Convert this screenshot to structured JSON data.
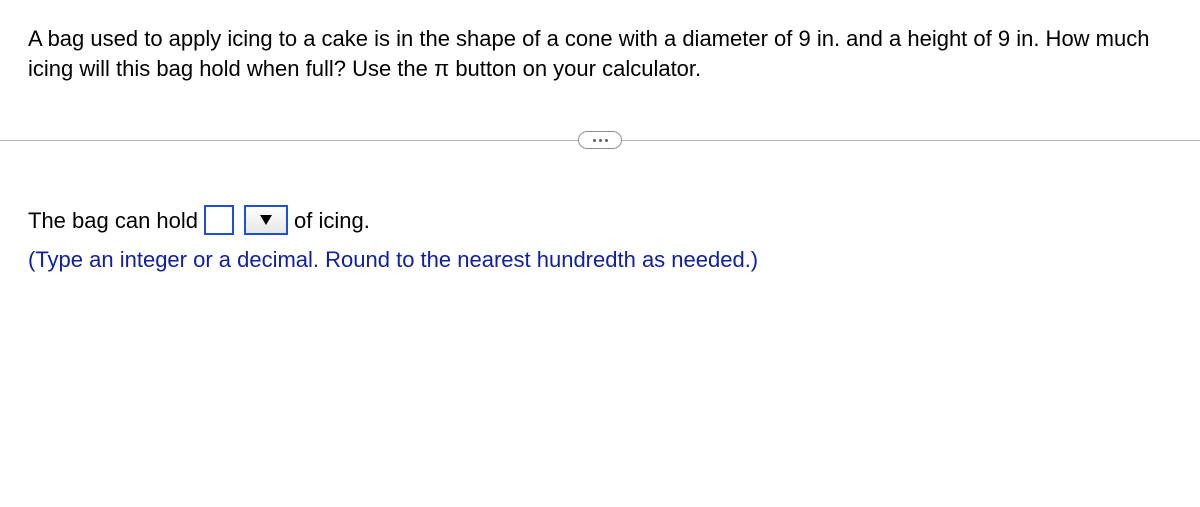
{
  "question": {
    "text_part_1": "A bag used to apply icing to a cake is in the shape of a cone with a diameter of 9 in. and a height of 9 in. How much icing will this bag hold when full? Use the ",
    "pi_symbol": "π",
    "text_part_2": " button on your calculator."
  },
  "answer": {
    "prefix": "The bag can hold",
    "input_value": "",
    "select_value": "",
    "suffix": "of icing.",
    "hint": "(Type an integer or a decimal. Round to the nearest hundredth as needed.)"
  }
}
